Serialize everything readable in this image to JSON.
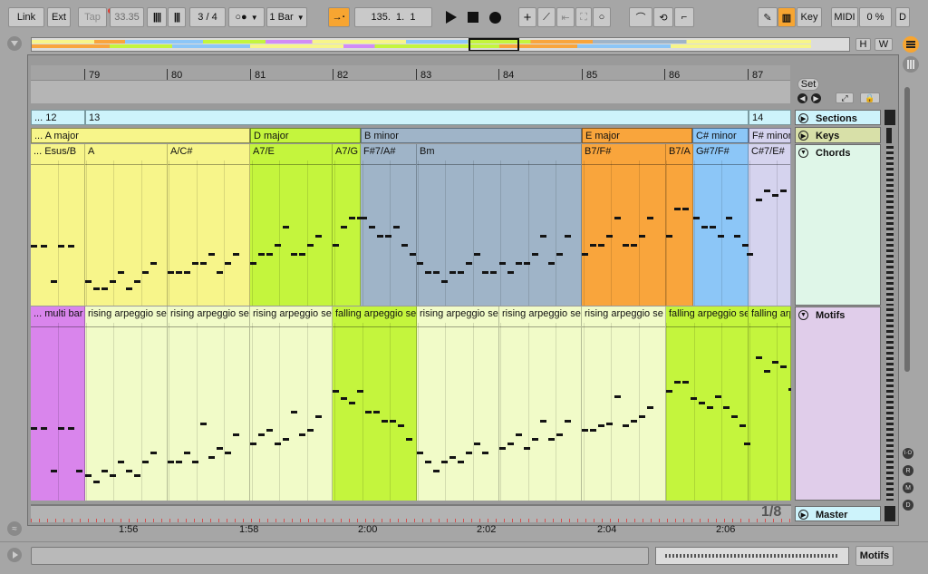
{
  "transport": {
    "link": "Link",
    "ext": "Ext",
    "tap": "Tap",
    "tempo": "33.35",
    "signature": "3 / 4",
    "quantize": "1 Bar",
    "position": "135.  1.  1",
    "key": "Key",
    "midi": "MIDI",
    "cpu": "0 %",
    "d": "D"
  },
  "overview": {
    "h": "H",
    "w": "W"
  },
  "ruler": {
    "bars": [
      "79",
      "80",
      "81",
      "82",
      "83",
      "84",
      "85",
      "86",
      "87"
    ]
  },
  "controls": {
    "set": "Set"
  },
  "tracks": {
    "sections": "Sections",
    "keys": "Keys",
    "chords": "Chords",
    "motifs": "Motifs",
    "master": "Master"
  },
  "sections": [
    {
      "label": "... 12",
      "color": "#cdf3fb"
    },
    {
      "label": "13",
      "color": "#cdf3fb"
    },
    {
      "label": "14",
      "color": "#cdf3fb"
    }
  ],
  "keys": [
    {
      "label": "... A major",
      "color": "#f7f58a"
    },
    {
      "label": "D major",
      "color": "#c4f53d"
    },
    {
      "label": "B minor",
      "color": "#9fb4c8"
    },
    {
      "label": "E major",
      "color": "#f9a53c"
    },
    {
      "label": "C# minor",
      "color": "#8cc6f7"
    },
    {
      "label": "F# minor",
      "color": "#d5d3ee"
    }
  ],
  "chords": [
    {
      "label": "... Esus/B"
    },
    {
      "label": "A"
    },
    {
      "label": "A/C#"
    },
    {
      "label": "A7/E"
    },
    {
      "label": "A7/G"
    },
    {
      "label": "F#7/A#"
    },
    {
      "label": "Bm"
    },
    {
      "label": "B7/F#"
    },
    {
      "label": "B7/A"
    },
    {
      "label": "G#7/F#"
    },
    {
      "label": "C#7/E#"
    }
  ],
  "motifs": [
    {
      "label": "... multi bar"
    },
    {
      "label": "rising arpeggio se"
    },
    {
      "label": "rising arpeggio se"
    },
    {
      "label": "rising arpeggio se"
    },
    {
      "label": "falling arpeggio se"
    },
    {
      "label": "rising arpeggio se"
    },
    {
      "label": "rising arpeggio se"
    },
    {
      "label": "rising arpeggio se"
    },
    {
      "label": "falling arpeggio se"
    },
    {
      "label": "falling arp"
    }
  ],
  "status": {
    "grid": "1/8",
    "times": [
      "1:56",
      "1:58",
      "2:00",
      "2:02",
      "2:04",
      "2:06"
    ],
    "view": "Motifs"
  },
  "side_buttons": {
    "io": "I·O",
    "r": "R",
    "m": "M",
    "d": "D"
  },
  "colors": {
    "accent_orange": "#f7a531",
    "toolbar": "#c9c9c9",
    "background": "#a6a6a6"
  }
}
